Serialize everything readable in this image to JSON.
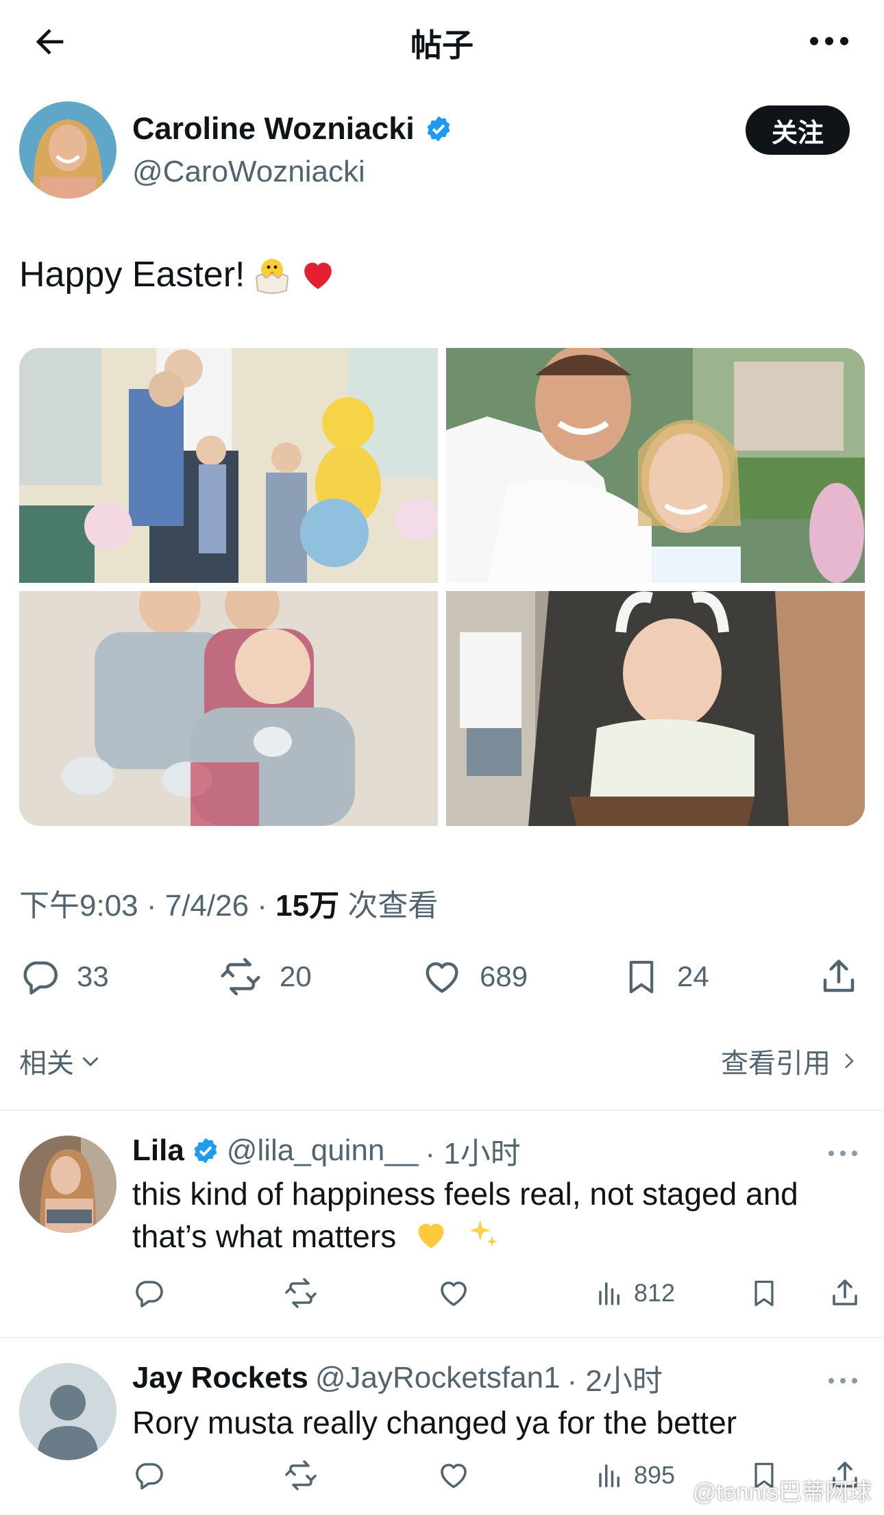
{
  "header": {
    "title": "帖子",
    "back_icon": "arrow-left-icon",
    "more_icon": "more-horizontal-icon"
  },
  "author": {
    "name": "Caroline Wozniacki",
    "handle": "@CaroWozniacki",
    "verified": true,
    "follow_label": "关注"
  },
  "post": {
    "text": "Happy Easter!",
    "emojis": [
      "hatching-chick-emoji",
      "red-heart-emoji"
    ],
    "photos": [
      "family-easter-photo",
      "couple-selfie-photo",
      "kids-pajamas-photo",
      "baby-stroller-photo"
    ]
  },
  "meta": {
    "time": "下午9:03 · 7/4/26 · ",
    "views_count": "15万",
    "views_label": " 次查看"
  },
  "actions": {
    "replies": "33",
    "reposts": "20",
    "likes": "689",
    "bookmarks": "24"
  },
  "related": {
    "label": "相关",
    "quotes_label": "查看引用"
  },
  "replies": [
    {
      "name": "Lila",
      "verified": true,
      "handle": "@lila_quinn__",
      "time": "· 1小时",
      "text": "this kind of happiness feels real, not staged and that’s what matters",
      "views": "812"
    },
    {
      "name": "Jay Rockets",
      "verified": false,
      "handle": "@JayRocketsfan1",
      "time": "· 2小时",
      "text": "Rory musta really changed ya for the better",
      "views": "895"
    }
  ],
  "watermark": "@tennis巴蒂网球",
  "colors": {
    "text": "#0f1419",
    "secondary": "#536471",
    "verified": "#1d9bf0",
    "heart": "#e0245e"
  }
}
